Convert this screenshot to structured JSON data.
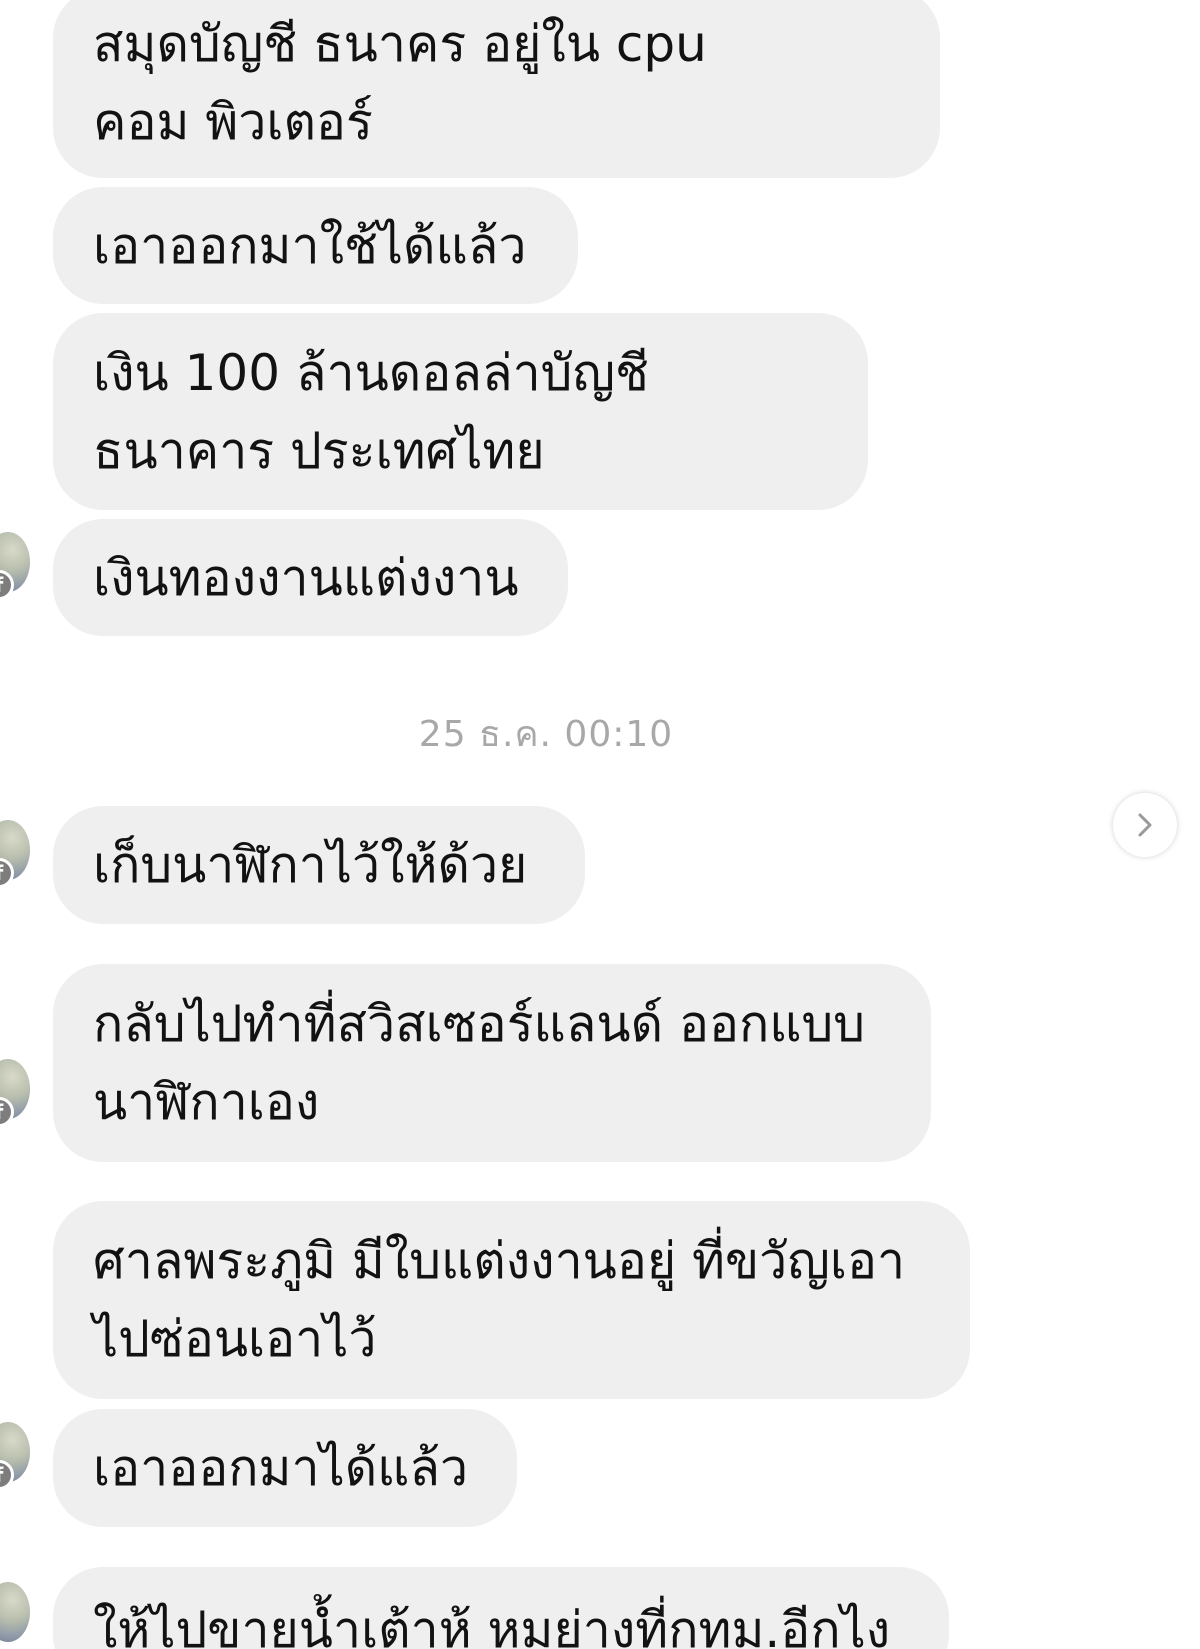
{
  "messages": [
    {
      "text": "สมุดบัญชี ธนาคร อยู่ใน cpu คอม พิวเตอร์"
    },
    {
      "text": "เอาออกมาใช้ได้แล้ว"
    },
    {
      "text": "เงิน 100 ล้านดอลล่าบัญชีธนาคาร ประเทศไทย"
    },
    {
      "text": "เงินทองงานแต่งงาน"
    },
    {
      "text": "เก็บนาฬิกาไว้ให้ด้วย"
    },
    {
      "text": "กลับไปทำที่สวิสเซอร์แลนด์ ออกแบบ นาฬิกาเอง"
    },
    {
      "text": "ศาลพระภูมิ มีใบแต่งงานอยู่ ที่ขวัญเอา ไปซ่อนเอาไว้"
    },
    {
      "text": "เอาออกมาได้แล้ว"
    },
    {
      "text": "ให้ไปขายน้ำเต้าหู้ หมูย่างที่กทม.อีกไง"
    }
  ],
  "timestamp": "25 ธ.ค. 00:10",
  "icons": {
    "badge": "facebook-icon",
    "badge_glyph": "f",
    "next": "chevron-right-icon"
  },
  "colors": {
    "bubble": "#efefef",
    "text": "#121212",
    "timestamp": "#a8a8a8"
  }
}
